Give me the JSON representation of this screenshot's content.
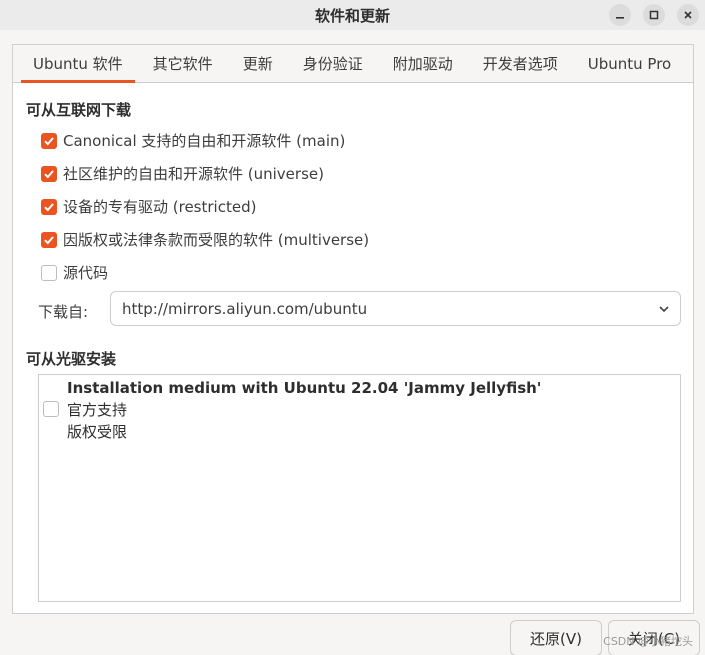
{
  "window": {
    "title": "软件和更新",
    "controls": [
      "minimize-icon",
      "maximize-icon",
      "close-icon"
    ]
  },
  "tabs": [
    {
      "label": "Ubuntu 软件",
      "active": true
    },
    {
      "label": "其它软件",
      "active": false
    },
    {
      "label": "更新",
      "active": false
    },
    {
      "label": "身份验证",
      "active": false
    },
    {
      "label": "附加驱动",
      "active": false
    },
    {
      "label": "开发者选项",
      "active": false
    },
    {
      "label": "Ubuntu Pro",
      "active": false
    }
  ],
  "internet": {
    "heading": "可从互联网下载",
    "options": [
      {
        "label": "Canonical 支持的自由和开源软件 (main)",
        "checked": true
      },
      {
        "label": "社区维护的自由和开源软件 (universe)",
        "checked": true
      },
      {
        "label": "设备的专有驱动 (restricted)",
        "checked": true
      },
      {
        "label": "因版权或法律条款而受限的软件 (multiverse)",
        "checked": true
      },
      {
        "label": "源代码",
        "checked": false
      }
    ],
    "download_from_label": "下载自:",
    "download_from_value": "http://mirrors.aliyun.com/ubuntu"
  },
  "cdrom": {
    "heading": "可从光驱安装",
    "item": {
      "name": "Installation medium with Ubuntu 22.04 'Jammy Jellyfish'",
      "line2": "官方支持",
      "line3": "版权受限",
      "checked": false
    }
  },
  "buttons": {
    "revert": "还原(V)",
    "close": "关闭(C)"
  },
  "watermark": "CSDN @小猪坨头",
  "colors": {
    "accent": "#e95420"
  }
}
